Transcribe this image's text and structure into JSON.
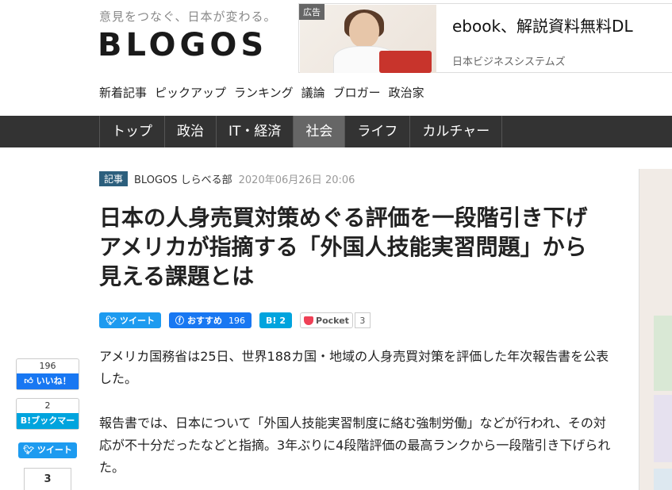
{
  "header": {
    "tagline": "意見をつなぐ、日本が変わる。",
    "logo": "BLOGOS"
  },
  "ad": {
    "badge": "広告",
    "title": "ebook、解説資料無料DL",
    "sponsor": "日本ビジネスシステムズ"
  },
  "subnav": [
    "新着記事",
    "ピックアップ",
    "ランキング",
    "議論",
    "ブロガー",
    "政治家"
  ],
  "mainnav": [
    {
      "label": "トップ",
      "active": false
    },
    {
      "label": "政治",
      "active": false
    },
    {
      "label": "IT・経済",
      "active": false
    },
    {
      "label": "社会",
      "active": true
    },
    {
      "label": "ライフ",
      "active": false
    },
    {
      "label": "カルチャー",
      "active": false
    }
  ],
  "article": {
    "tag": "記事",
    "author": "BLOGOS しらべる部",
    "date": "2020年06月26日 20:06",
    "title": "日本の人身売買対策めぐる評価を一段階引き下げ アメリカが指摘する「外国人技能実習問題」から見える課題とは",
    "paragraphs": [
      "アメリカ国務省は25日、世界188カ国・地域の人身売買対策を評価した年次報告書を公表した。",
      "報告書では、日本について「外国人技能実習制度に絡む強制労働」などが行われ、その対応が不十分だったなどと指摘。3年ぶりに4段階評価の最高ランクから一段階引き下げられた。"
    ]
  },
  "share": {
    "tweet": "ツイート",
    "fb_label": "おすすめ",
    "fb_count": "196",
    "hatena_label": "B!",
    "hatena_count": "2",
    "pocket_label": "Pocket",
    "pocket_count": "3"
  },
  "side_share": {
    "fb_count": "196",
    "fb_label": "いいね！",
    "hatena_count": "2",
    "hatena_label": "B!ブックマーク",
    "tweet": "ツイート",
    "pocket_count": "3"
  },
  "colors": {
    "nav_bg": "#333333",
    "nav_active": "#666666",
    "tag_bg": "#2c5f7d",
    "twitter": "#1d9bf0",
    "facebook": "#1877f2",
    "hatena": "#00a4de",
    "pocket": "#ef4056"
  }
}
